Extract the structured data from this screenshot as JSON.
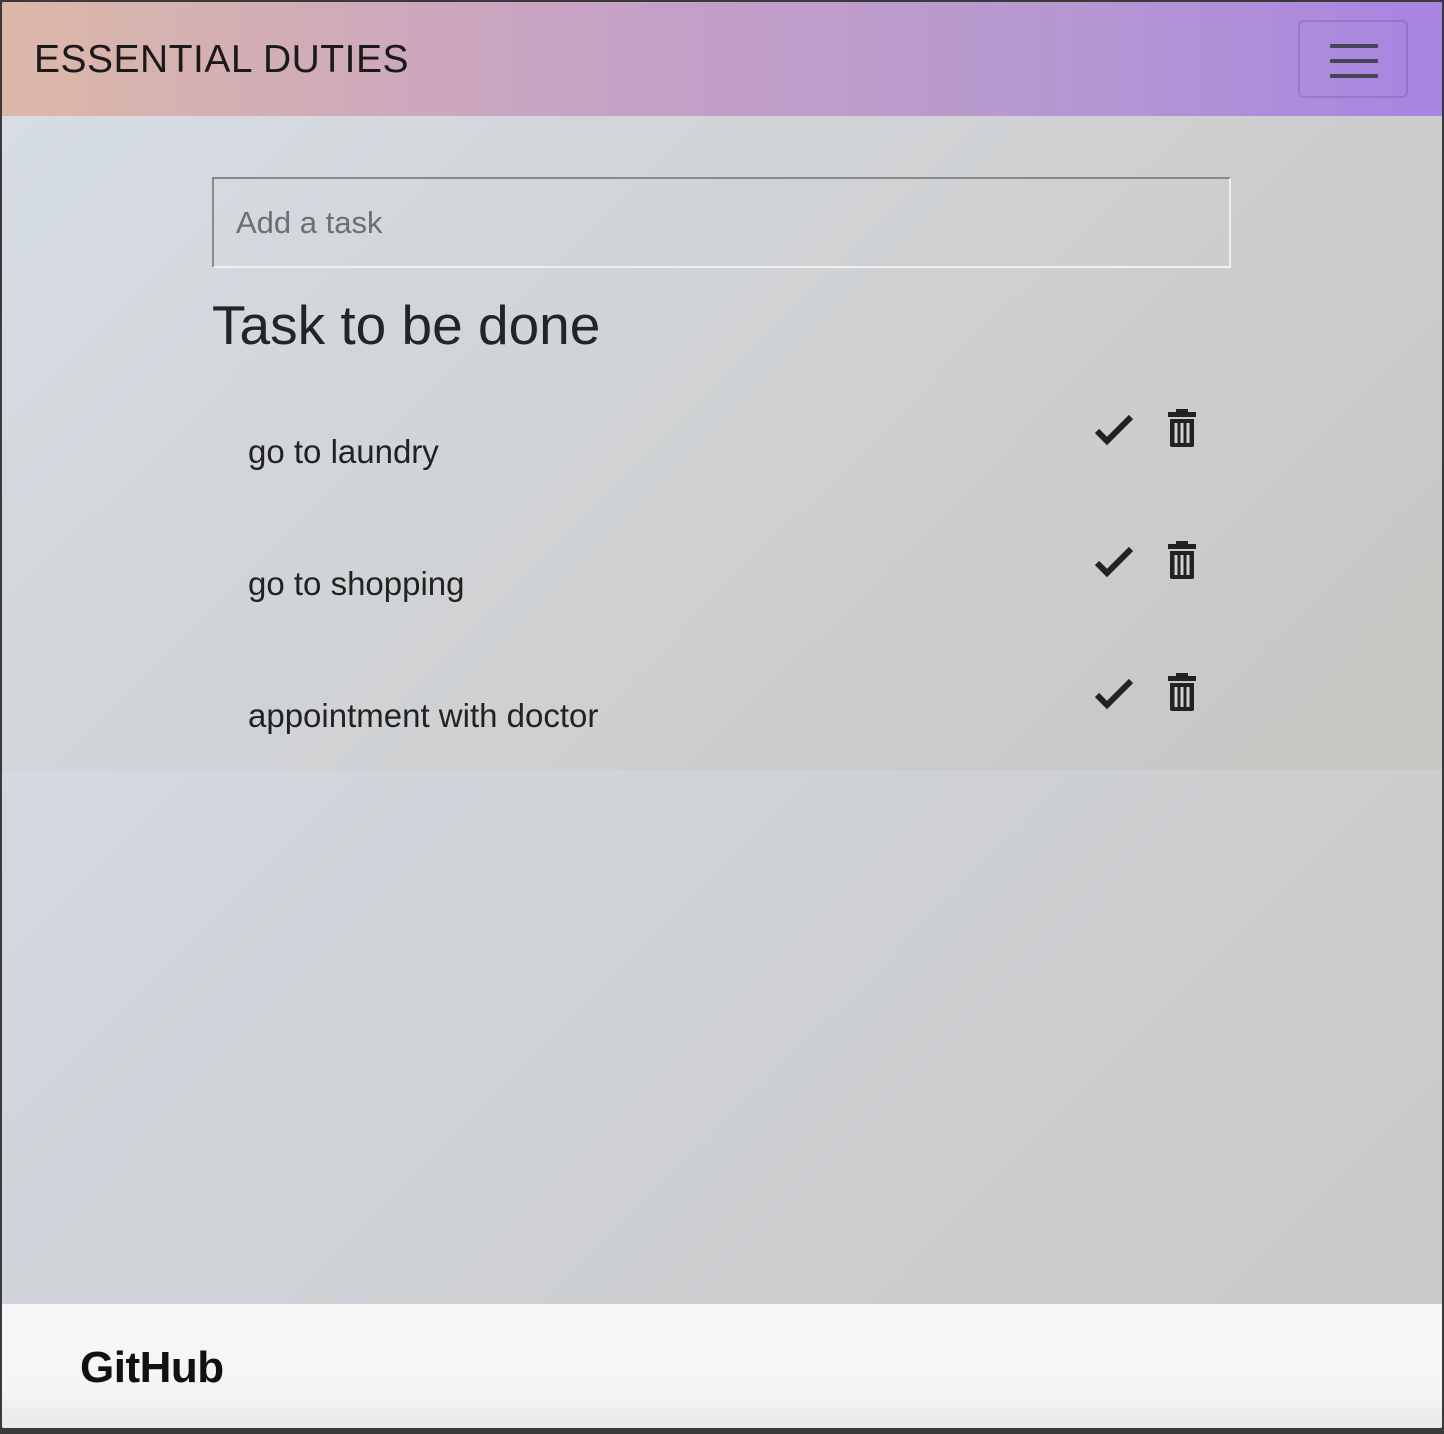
{
  "navbar": {
    "brand": "ESSENTIAL DUTIES",
    "toggler_icon": "hamburger-menu-icon"
  },
  "input": {
    "placeholder": "Add a task",
    "value": ""
  },
  "section": {
    "title": "Task to be done"
  },
  "tasks": [
    {
      "label": "go to laundry",
      "complete_icon": "checkmark-icon",
      "delete_icon": "trash-icon"
    },
    {
      "label": "go to shopping",
      "complete_icon": "checkmark-icon",
      "delete_icon": "trash-icon"
    },
    {
      "label": "appointment with doctor",
      "complete_icon": "checkmark-icon",
      "delete_icon": "trash-icon"
    }
  ],
  "footer": {
    "link_label": "GitHub"
  },
  "colors": {
    "navbar_gradient_start": "#dcb8a8",
    "navbar_gradient_end": "#a884e2",
    "text_dark": "#212529",
    "footer_bg": "#f7f7f8"
  }
}
